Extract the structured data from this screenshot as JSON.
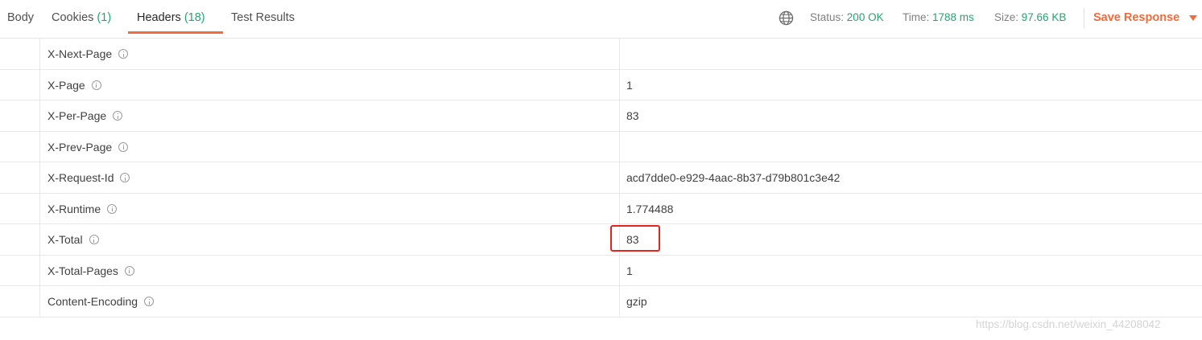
{
  "tabs": [
    {
      "label": "Body",
      "count": ""
    },
    {
      "label": "Cookies",
      "count": "(1)"
    },
    {
      "label": "Headers",
      "count": "(18)"
    },
    {
      "label": "Test Results",
      "count": ""
    }
  ],
  "active_tab": "Headers",
  "response_meta": {
    "status_label": "Status:",
    "status_value": "200 OK",
    "time_label": "Time:",
    "time_value": "1788 ms",
    "size_label": "Size:",
    "size_value": "97.66 KB"
  },
  "save_response_label": "Save Response",
  "headers": [
    {
      "key": "X-Next-Page",
      "value": ""
    },
    {
      "key": "X-Page",
      "value": "1"
    },
    {
      "key": "X-Per-Page",
      "value": "83"
    },
    {
      "key": "X-Prev-Page",
      "value": ""
    },
    {
      "key": "X-Request-Id",
      "value": "acd7dde0-e929-4aac-8b37-d79b801c3e42"
    },
    {
      "key": "X-Runtime",
      "value": "1.774488"
    },
    {
      "key": "X-Total",
      "value": "83"
    },
    {
      "key": "X-Total-Pages",
      "value": "1"
    },
    {
      "key": "Content-Encoding",
      "value": "gzip"
    }
  ],
  "highlighted_header": "X-Total",
  "watermark": "https://blog.csdn.net/weixin_44208042",
  "colors": {
    "accent": "#f26b3a",
    "status_green": "#26a36f",
    "highlight_red": "#e8231b"
  },
  "icons": {
    "globe": "globe-icon",
    "info": "info-icon",
    "dropdown": "caret-down-icon"
  }
}
